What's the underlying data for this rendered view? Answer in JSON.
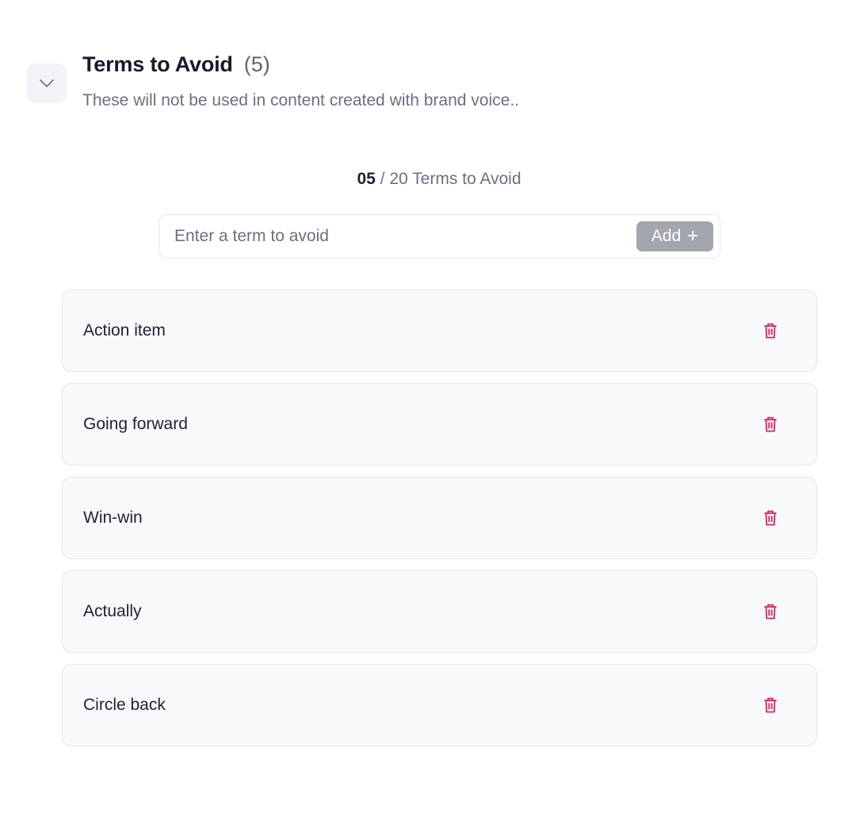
{
  "header": {
    "title": "Terms to Avoid",
    "count": "(5)",
    "subtitle": "These will not be used in content created with brand voice..",
    "collapse_icon": "chevron-down-icon"
  },
  "counter": {
    "current": "05",
    "rest": " / 20 Terms to Avoid"
  },
  "input": {
    "placeholder": "Enter a term to avoid",
    "value": "",
    "add_label": "Add",
    "add_icon": "plus-icon"
  },
  "terms": [
    {
      "label": "Action item"
    },
    {
      "label": "Going forward"
    },
    {
      "label": "Win-win"
    },
    {
      "label": "Actually"
    },
    {
      "label": "Circle back"
    }
  ],
  "colors": {
    "delete_icon": "#d6245a",
    "add_button_disabled": "#a3a6ae",
    "row_background": "#f8f9fb",
    "border": "#e3e6ed"
  },
  "icons": {
    "delete": "trash-icon"
  }
}
